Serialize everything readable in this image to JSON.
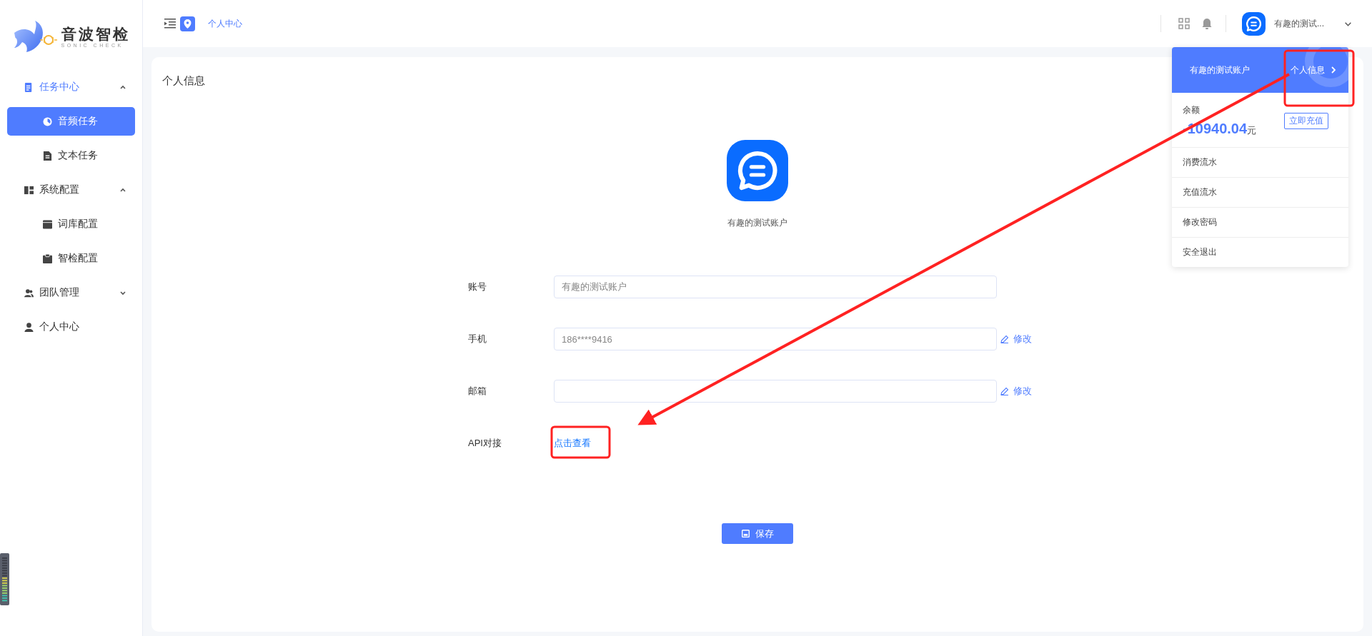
{
  "sidebar": {
    "logo": {
      "title": "音波智检",
      "subtitle": "SONIC CHECK"
    },
    "items": [
      {
        "label": "任务中心",
        "expanded": true,
        "children": [
          {
            "label": "音频任务",
            "selected": true
          },
          {
            "label": "文本任务",
            "selected": false
          }
        ]
      },
      {
        "label": "系统配置",
        "expanded": true,
        "children": [
          {
            "label": "词库配置",
            "selected": false
          },
          {
            "label": "智检配置",
            "selected": false
          }
        ]
      },
      {
        "label": "团队管理",
        "expanded": false
      },
      {
        "label": "个人中心",
        "selected": false
      }
    ]
  },
  "header": {
    "breadcrumb": "个人中心",
    "user_name": "有趣的测试..."
  },
  "page": {
    "title": "个人信息",
    "profile_name": "有趣的测试账户",
    "fields": [
      {
        "kind": "input",
        "label": "账号",
        "value": "有趣的测试账户"
      },
      {
        "kind": "input",
        "label": "手机",
        "value": "186****9416",
        "edit_link": "修改"
      },
      {
        "kind": "input",
        "label": "邮箱",
        "edit_link": "修改"
      },
      {
        "kind": "link",
        "label": "API对接",
        "link": "点击查看"
      }
    ],
    "save_button": "保存"
  },
  "dropdown": {
    "account_name": "有趣的测试账户",
    "profile_link": "个人信息",
    "balance_label": "余额",
    "balance_amount": "-10940.04",
    "balance_unit": "元",
    "recharge_button": "立即充值",
    "items": [
      "消费流水",
      "充值流水",
      "修改密码",
      "安全退出"
    ]
  }
}
